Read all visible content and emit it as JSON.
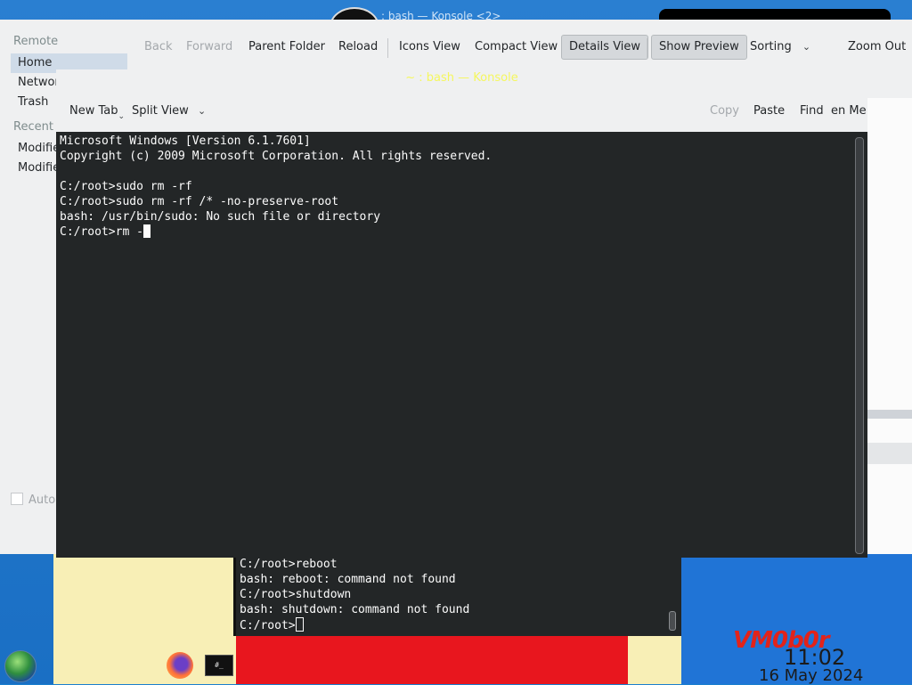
{
  "desktop": {
    "background_title": ": bash — Konsole <2>",
    "brand_label": "VM0b0r",
    "clock": {
      "time": "11:02",
      "date": "16 May 2024"
    },
    "taskbar_icons": [
      "start-orb-icon",
      "firefox-icon",
      "konsole-icon"
    ],
    "konsole_icon_text": "#_"
  },
  "file_manager": {
    "sidebar": {
      "remote_heading": "Remote",
      "items": [
        {
          "label": "Home",
          "active": true
        },
        {
          "label": "Network",
          "active": false
        },
        {
          "label": "Trash",
          "active": false
        }
      ],
      "recent_heading": "Recent",
      "recent_items": [
        "Modifie",
        "Modifie"
      ],
      "autoplay_label": "Auto"
    },
    "toolbar": {
      "back": "Back",
      "forward": "Forward",
      "parent_folder": "Parent Folder",
      "reload": "Reload",
      "icons_view": "Icons View",
      "compact_view": "Compact View",
      "details_view": "Details View",
      "show_preview": "Show Preview",
      "sorting": "Sorting",
      "zoom_out": "Zoom Out"
    }
  },
  "konsole": {
    "title": "~ : bash — Konsole",
    "toolbar": {
      "new_tab": "New Tab",
      "split_view": "Split View",
      "copy": "Copy",
      "paste": "Paste",
      "find": "Find",
      "menu": "en Me"
    },
    "terminal_text": "Microsoft Windows [Version 6.1.7601]\nCopyright (c) 2009 Microsoft Corporation. All rights reserved.\n\nC:/root>sudo rm -rf\nC:/root>sudo rm -rf /* -no-preserve-root\nbash: /usr/bin/sudo: No such file or directory\nC:/root>rm -"
  },
  "second_terminal": {
    "terminal_text": "C:/root>reboot\nbash: reboot: command not found\nC:/root>shutdown\nbash: shutdown: command not found\nC:/root>"
  },
  "colors": {
    "terminal_bg": "#232627",
    "terminal_fg": "#fcfcfc",
    "konsole_title": "#f5f75e",
    "brand": "#e2231a",
    "active_sidebar": "#cfdbe8"
  }
}
